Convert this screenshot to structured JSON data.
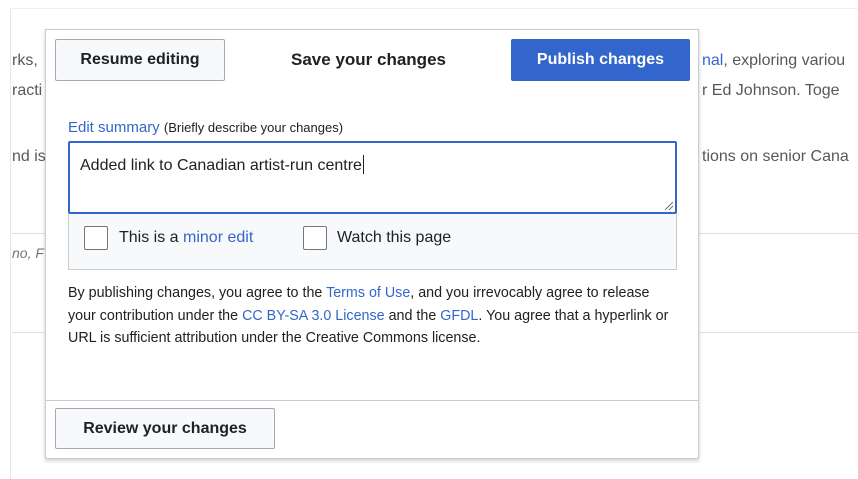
{
  "background": {
    "line1_start": "rks,",
    "line1_link": "nal",
    "line1_end": ", exploring variou",
    "line2_start": "racti",
    "line2_end": "r Ed Johnson. Toge",
    "line3_start": "nd is",
    "line3_end": "tions on senior Cana",
    "italic_start": "no, F"
  },
  "dialog": {
    "resume_label": "Resume editing",
    "title": "Save your changes",
    "publish_label": "Publish changes",
    "summary_link": "Edit summary",
    "summary_hint": "(Briefly describe your changes)",
    "summary_value": "Added link to Canadian artist-run centre",
    "minor_prefix": "This is a ",
    "minor_link": "minor edit",
    "watch_label": "Watch this page",
    "legal_1": "By publishing changes, you agree to the ",
    "legal_terms": "Terms of Use",
    "legal_2": ", and you irrevocably agree to release your contribution under the ",
    "legal_cc": "CC BY-SA 3.0 License",
    "legal_3": " and the ",
    "legal_gfdl": "GFDL",
    "legal_4": ". You agree that a hyperlink or URL is sufficient attribution under the Creative Commons license.",
    "review_label": "Review your changes"
  },
  "colors": {
    "accent": "#3366cc",
    "border": "#c8ccd1",
    "text": "#202122"
  }
}
